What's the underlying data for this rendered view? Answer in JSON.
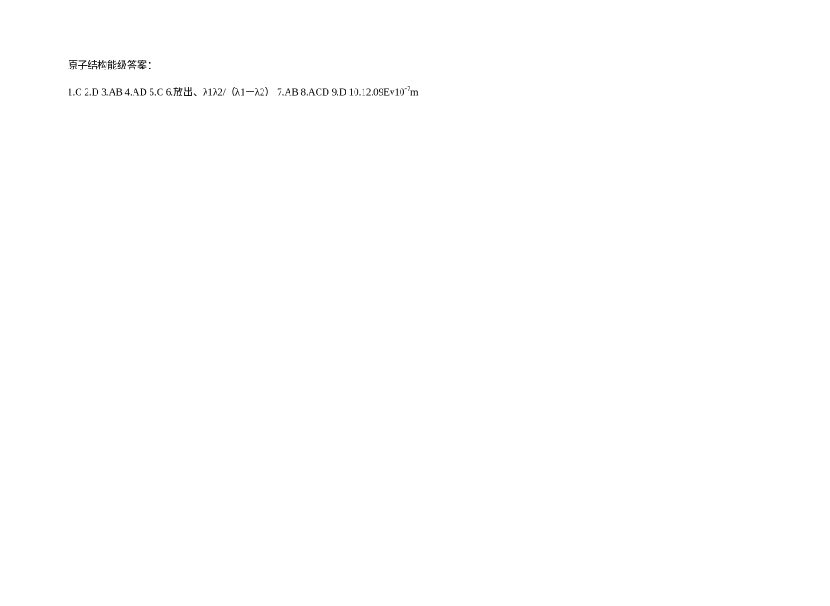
{
  "title": "原子结构能级答案：",
  "answers": {
    "part1": "1.C 2.D 3.AB 4.AD 5.C   6.放出、λ1λ2/（λ1－λ2） 7.AB  8.ACD  9.D 10.12.09Ev10",
    "exponent": "-7",
    "part2": "m"
  }
}
